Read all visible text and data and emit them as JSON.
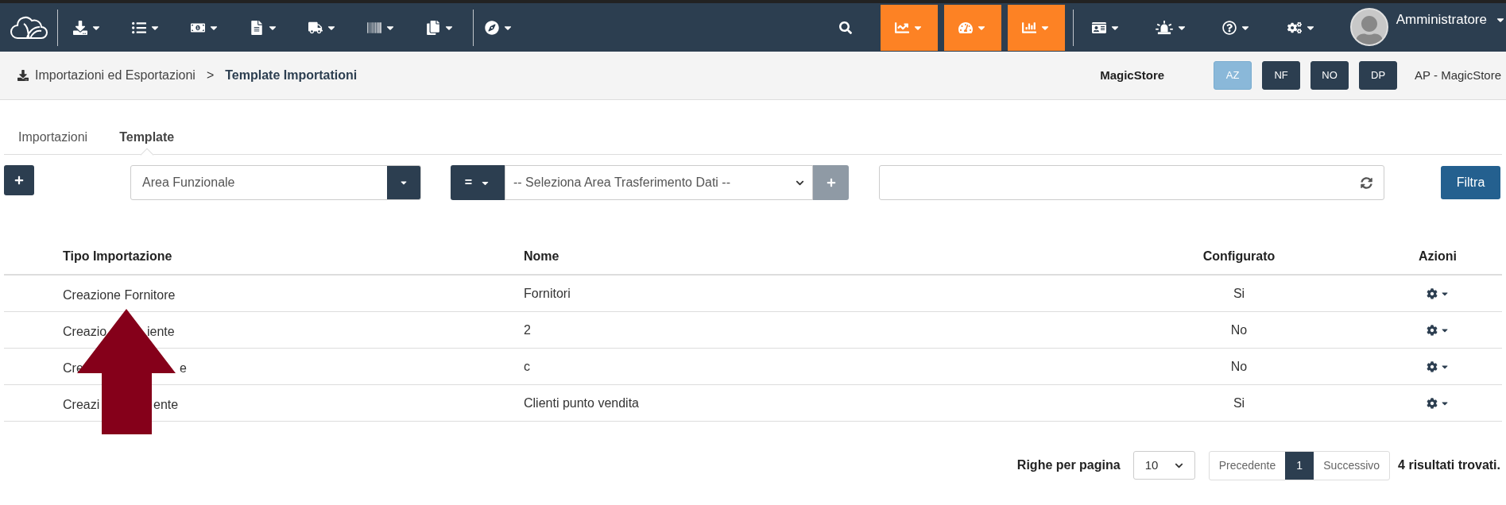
{
  "navbar": {
    "menus": [
      {
        "highlighted": false
      },
      {
        "highlighted": false
      },
      {
        "highlighted": false
      },
      {
        "highlighted": false
      },
      {
        "highlighted": false
      },
      {
        "highlighted": false
      },
      {
        "highlighted": false
      },
      {
        "highlighted": false
      }
    ],
    "right_menus": [
      {
        "highlighted": true
      },
      {
        "highlighted": true
      },
      {
        "highlighted": true
      },
      {
        "highlighted": false
      },
      {
        "highlighted": false
      },
      {
        "highlighted": false
      },
      {
        "highlighted": false
      }
    ],
    "user": "Amministratore"
  },
  "breadcrumb": {
    "parent": "Importazioni ed Esportazioni",
    "separator": ">",
    "current": "Template Importationi"
  },
  "company": {
    "name": "MagicStore",
    "badges": [
      {
        "label": "AZ",
        "selected": true
      },
      {
        "label": "NF",
        "selected": false
      },
      {
        "label": "NO",
        "selected": false
      },
      {
        "label": "DP",
        "selected": false
      }
    ],
    "store": "AP - MagicStore"
  },
  "tabs": [
    {
      "label": "Importazioni",
      "selected": false
    },
    {
      "label": "Template",
      "selected": true
    }
  ],
  "filters": {
    "area": "Area Funzionale",
    "operator": "=",
    "transfer_area": "-- Seleziona Area Trasferimento Dati --",
    "button": "Filtra"
  },
  "table": {
    "columns": [
      "Tipo Importazione",
      "Nome",
      "Configurato",
      "Azioni"
    ],
    "rows": [
      {
        "tipo": [
          "Creazione Fornitore"
        ],
        "nome": "Fornitori",
        "configurato": "Si"
      },
      {
        "tipo": [
          "Creazio",
          "iente"
        ],
        "nome": "2",
        "configurato": "No"
      },
      {
        "tipo": [
          "Cre",
          "e"
        ],
        "nome": "c",
        "configurato": "No"
      },
      {
        "tipo": [
          "Creazi",
          "ente"
        ],
        "nome": "Clienti punto vendita",
        "configurato": "Si"
      }
    ]
  },
  "pagination": {
    "rows_label": "Righe per pagina",
    "page_size": "10",
    "previous": "Precedente",
    "pages": [
      {
        "label": "1",
        "selected": true
      }
    ],
    "next": "Successivo",
    "results": "4 risultati trovati."
  }
}
